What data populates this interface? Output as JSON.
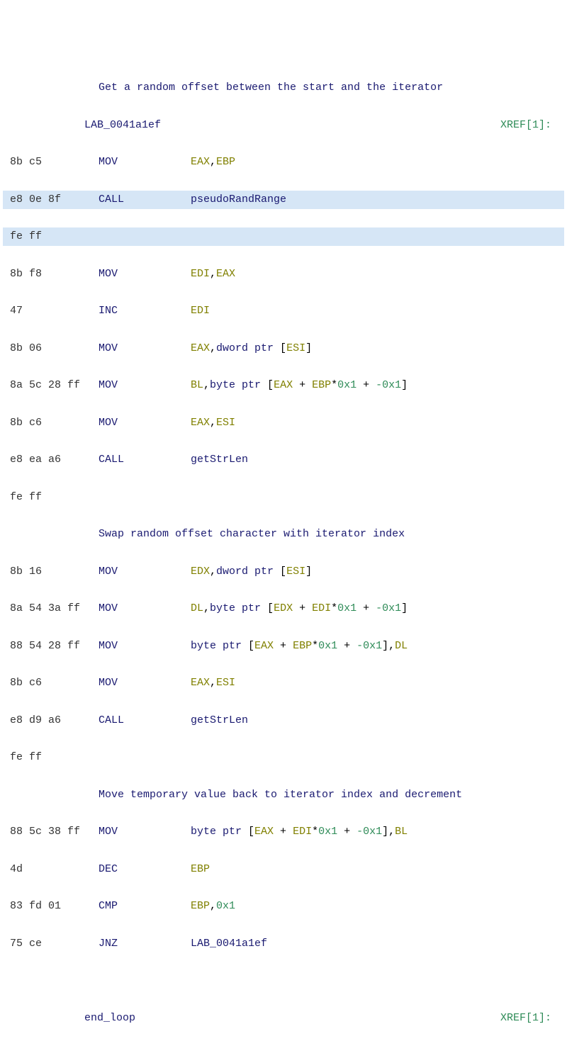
{
  "comment1": "Get a random offset between the start and the iterator",
  "label1": "LAB_0041a1ef",
  "xref1": "XREF[1]:",
  "r1": {
    "bytes": "8b c5",
    "mnem": "MOV",
    "op_html": "<span class='reg'>EAX</span><span class='punc'>,</span><span class='reg'>EBP</span>"
  },
  "r2": {
    "bytes": "e8 0e 8f",
    "mnem": "CALL",
    "op_html": "<span class='func'>pseudoRandRange</span>"
  },
  "r2b": {
    "bytes": "fe ff"
  },
  "r3": {
    "bytes": "8b f8",
    "mnem": "MOV",
    "op_html": "<span class='reg'>EDI</span><span class='punc'>,</span><span class='reg'>EAX</span>"
  },
  "r4": {
    "bytes": "47",
    "mnem": "INC",
    "op_html": "<span class='reg'>EDI</span>"
  },
  "r5": {
    "bytes": "8b 06",
    "mnem": "MOV",
    "op_html": "<span class='reg'>EAX</span><span class='punc'>,</span><span class='kw'>dword ptr </span><span class='punc'>[</span><span class='reg'>ESI</span><span class='punc'>]</span>"
  },
  "r6": {
    "bytes": "8a 5c 28 ff",
    "mnem": "MOV",
    "op_html": "<span class='reg'>BL</span><span class='punc'>,</span><span class='kw'>byte ptr </span><span class='punc'>[</span><span class='reg'>EAX</span><span class='punc'> + </span><span class='reg'>EBP</span><span class='punc'>*</span><span class='num'>0x1</span><span class='punc'> + </span><span class='num'>-0x1</span><span class='punc'>]</span>"
  },
  "r7": {
    "bytes": "8b c6",
    "mnem": "MOV",
    "op_html": "<span class='reg'>EAX</span><span class='punc'>,</span><span class='reg'>ESI</span>"
  },
  "r8": {
    "bytes": "e8 ea a6",
    "mnem": "CALL",
    "op_html": "<span class='func'>getStrLen</span>"
  },
  "r8b": {
    "bytes": "fe ff"
  },
  "comment2": "Swap random offset character with iterator index",
  "r9": {
    "bytes": "8b 16",
    "mnem": "MOV",
    "op_html": "<span class='reg'>EDX</span><span class='punc'>,</span><span class='kw'>dword ptr </span><span class='punc'>[</span><span class='reg'>ESI</span><span class='punc'>]</span>"
  },
  "r10": {
    "bytes": "8a 54 3a ff",
    "mnem": "MOV",
    "op_html": "<span class='reg'>DL</span><span class='punc'>,</span><span class='kw'>byte ptr </span><span class='punc'>[</span><span class='reg'>EDX</span><span class='punc'> + </span><span class='reg'>EDI</span><span class='punc'>*</span><span class='num'>0x1</span><span class='punc'> + </span><span class='num'>-0x1</span><span class='punc'>]</span>"
  },
  "r11": {
    "bytes": "88 54 28 ff",
    "mnem": "MOV",
    "op_html": "<span class='kw'>byte ptr </span><span class='punc'>[</span><span class='reg'>EAX</span><span class='punc'> + </span><span class='reg'>EBP</span><span class='punc'>*</span><span class='num'>0x1</span><span class='punc'> + </span><span class='num'>-0x1</span><span class='punc'>],</span><span class='reg'>DL</span>"
  },
  "r12": {
    "bytes": "8b c6",
    "mnem": "MOV",
    "op_html": "<span class='reg'>EAX</span><span class='punc'>,</span><span class='reg'>ESI</span>"
  },
  "r13": {
    "bytes": "e8 d9 a6",
    "mnem": "CALL",
    "op_html": "<span class='func'>getStrLen</span>"
  },
  "r13b": {
    "bytes": "fe ff"
  },
  "comment3": "Move temporary value back to iterator index and decrement",
  "r14": {
    "bytes": "88 5c 38 ff",
    "mnem": "MOV",
    "op_html": "<span class='kw'>byte ptr </span><span class='punc'>[</span><span class='reg'>EAX</span><span class='punc'> + </span><span class='reg'>EDI</span><span class='punc'>*</span><span class='num'>0x1</span><span class='punc'> + </span><span class='num'>-0x1</span><span class='punc'>],</span><span class='reg'>BL</span>"
  },
  "r15": {
    "bytes": "4d",
    "mnem": "DEC",
    "op_html": "<span class='reg'>EBP</span>"
  },
  "r16": {
    "bytes": "83 fd 01",
    "mnem": "CMP",
    "op_html": "<span class='reg'>EBP</span><span class='punc'>,</span><span class='num'>0x1</span>"
  },
  "r17": {
    "bytes": "75 ce",
    "mnem": "JNZ",
    "op_html": "<span class='lbl'>LAB_0041a1ef</span>"
  },
  "label2": "end_loop",
  "xref2": "XREF[1]:"
}
